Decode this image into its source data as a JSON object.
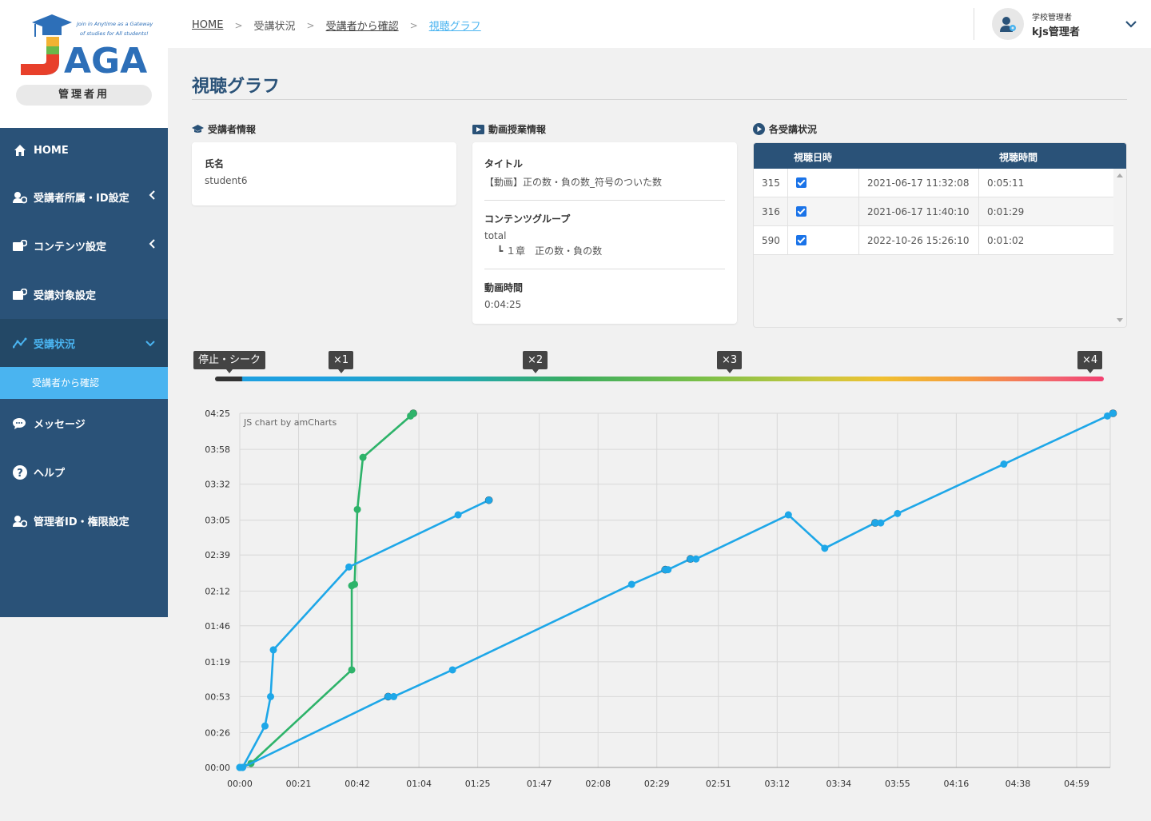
{
  "app": {
    "logo_tagline_1": "Join in Anytime as a Gateway",
    "logo_tagline_2": "of studies for All students!",
    "logo_letters": "AGA",
    "logo_sub": "管理者用"
  },
  "sidebar": {
    "items": [
      {
        "label": "HOME",
        "icon": "home-icon"
      },
      {
        "label": "受講者所属・ID設定",
        "icon": "user-settings-icon"
      },
      {
        "label": "コンテンツ設定",
        "icon": "content-settings-icon"
      },
      {
        "label": "受講対象設定",
        "icon": "target-settings-icon"
      },
      {
        "label": "受講状況",
        "icon": "chart-line-icon"
      },
      {
        "label": "メッセージ",
        "icon": "message-icon"
      },
      {
        "label": "ヘルプ",
        "icon": "help-icon"
      },
      {
        "label": "管理者ID・権限設定",
        "icon": "admin-settings-icon"
      }
    ],
    "sub_item": "受講者から確認"
  },
  "header": {
    "breadcrumb": [
      "HOME",
      "受講状況",
      "受講者から確認",
      "視聴グラフ"
    ],
    "user_role": "学校管理者",
    "user_name": "kjs管理者"
  },
  "page": {
    "title": "視聴グラフ"
  },
  "student_info": {
    "heading": "受講者情報",
    "name_label": "氏名",
    "name_value": "student6"
  },
  "video_info": {
    "heading": "動画授業情報",
    "title_label": "タイトル",
    "title_value": "【動画】正の数・負の数_符号のついた数",
    "group_label": "コンテンツグループ",
    "group_value": "total",
    "group_child_prefix": "┗",
    "group_child": "１章　正の数・負の数",
    "duration_label": "動画時間",
    "duration_value": "0:04:25"
  },
  "status": {
    "heading": "各受講状況",
    "col_date": "視聴日時",
    "col_time": "視聴時間",
    "rows": [
      {
        "id": "315",
        "checked": true,
        "date": "2021-06-17 11:32:08",
        "time": "0:05:11"
      },
      {
        "id": "316",
        "checked": true,
        "date": "2021-06-17 11:40:10",
        "time": "0:01:29"
      },
      {
        "id": "590",
        "checked": true,
        "date": "2022-10-26 15:26:10",
        "time": "0:01:02"
      }
    ]
  },
  "speed_legend": {
    "labels": [
      "停止・シーク",
      "×1",
      "×2",
      "×3",
      "×4"
    ]
  },
  "colors": {
    "sidebar": "#2a5278",
    "accent": "#4ab4f0",
    "series_blue": "#1ea7e8",
    "series_green": "#2eb36a",
    "seek_marker": "#333333"
  },
  "chart_data": {
    "type": "line",
    "credit": "JS chart by amCharts",
    "x_ticks": [
      "00:00",
      "00:21",
      "00:42",
      "01:04",
      "01:25",
      "01:47",
      "02:08",
      "02:29",
      "02:51",
      "03:12",
      "03:34",
      "03:55",
      "04:16",
      "04:38",
      "04:59"
    ],
    "y_ticks": [
      "00:00",
      "00:26",
      "00:53",
      "01:19",
      "01:46",
      "02:12",
      "02:39",
      "03:05",
      "03:32",
      "03:58",
      "04:25"
    ],
    "xlim_sec": [
      0,
      311
    ],
    "ylim_sec": [
      0,
      265
    ],
    "grid": true,
    "series": [
      {
        "color": "#2eb36a",
        "points": [
          [
            0,
            0
          ],
          [
            4,
            3
          ],
          [
            40,
            73
          ],
          [
            40,
            136
          ],
          [
            41,
            137
          ],
          [
            42,
            193
          ],
          [
            44,
            232
          ],
          [
            61,
            263
          ],
          [
            62,
            265
          ]
        ],
        "seek_markers": [
          [
            62,
            265
          ]
        ]
      },
      {
        "color": "#1ea7e8",
        "points": [
          [
            0,
            0
          ],
          [
            1,
            0
          ],
          [
            9,
            31
          ],
          [
            11,
            53
          ],
          [
            12,
            88
          ],
          [
            39,
            150
          ],
          [
            78,
            189
          ],
          [
            89,
            200
          ]
        ],
        "seek_markers": [
          [
            89,
            200
          ]
        ]
      },
      {
        "color": "#1ea7e8",
        "points": [
          [
            0,
            0
          ],
          [
            1,
            0
          ],
          [
            53,
            53
          ],
          [
            55,
            53
          ],
          [
            76,
            73
          ],
          [
            140,
            137
          ],
          [
            152,
            148
          ],
          [
            153,
            148
          ],
          [
            161,
            156
          ],
          [
            163,
            156
          ],
          [
            196,
            189
          ],
          [
            209,
            164
          ],
          [
            227,
            183
          ],
          [
            229,
            183
          ],
          [
            235,
            190
          ],
          [
            273,
            227
          ],
          [
            310,
            263
          ],
          [
            312,
            265
          ]
        ],
        "seek_markers": [
          [
            53,
            53
          ],
          [
            152,
            148
          ],
          [
            161,
            156
          ],
          [
            227,
            183
          ],
          [
            312,
            265
          ]
        ]
      }
    ]
  }
}
